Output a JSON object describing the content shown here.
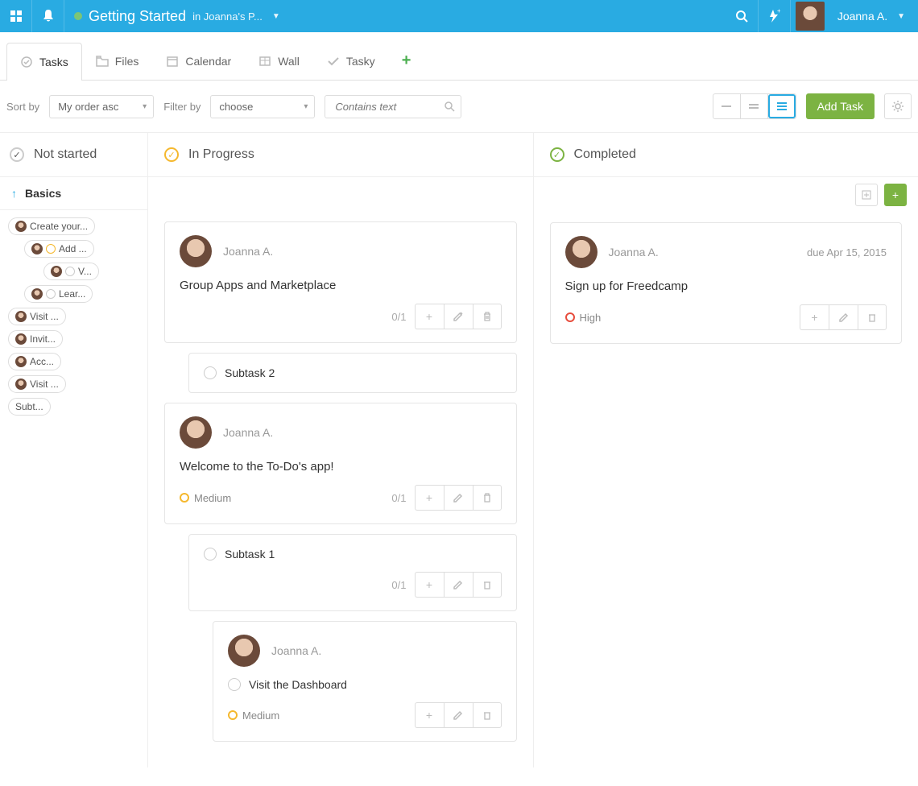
{
  "header": {
    "title": "Getting Started",
    "subtitle": "in Joanna's P...",
    "user_name": "Joanna A."
  },
  "tabs": [
    {
      "label": "Tasks",
      "active": true
    },
    {
      "label": "Files",
      "active": false
    },
    {
      "label": "Calendar",
      "active": false
    },
    {
      "label": "Wall",
      "active": false
    },
    {
      "label": "Tasky",
      "active": false
    }
  ],
  "toolbar": {
    "sort_label": "Sort by",
    "sort_value": "My order asc",
    "filter_label": "Filter by",
    "filter_value": "choose",
    "search_placeholder": "Contains text",
    "add_task_label": "Add Task"
  },
  "columns": {
    "not_started": {
      "title": "Not started"
    },
    "in_progress": {
      "title": "In Progress"
    },
    "completed": {
      "title": "Completed"
    }
  },
  "group": {
    "name": "Basics"
  },
  "mini_tasks": [
    {
      "label": "Create your...",
      "indent": 0,
      "avatar": true
    },
    {
      "label": "Add ...",
      "indent": 1,
      "avatar": true,
      "circle": "yellow"
    },
    {
      "label": "V...",
      "indent": 2,
      "avatar": true,
      "circle": "grey"
    },
    {
      "label": "Lear...",
      "indent": 1,
      "avatar": true,
      "circle": "grey"
    },
    {
      "label": "Visit ...",
      "indent": 0,
      "avatar": true
    },
    {
      "label": "Invit...",
      "indent": 0,
      "avatar": true
    },
    {
      "label": "Acc...",
      "indent": 0,
      "avatar": true
    },
    {
      "label": "Visit ...",
      "indent": 0,
      "avatar": true
    },
    {
      "label": "Subt...",
      "indent": 0,
      "avatar": false
    }
  ],
  "in_progress_cards": [
    {
      "user": "Joanna A.",
      "title": "Group Apps and Marketplace",
      "count": "0/1",
      "priority": null,
      "subtasks": [
        {
          "title": "Subtask 2",
          "count": null
        }
      ]
    },
    {
      "user": "Joanna A.",
      "title": "Welcome to the To-Do's app!",
      "count": "0/1",
      "priority": {
        "label": "Medium",
        "level": "med"
      },
      "subtasks": [
        {
          "title": "Subtask 1",
          "count": "0/1",
          "nested": [
            {
              "user": "Joanna A.",
              "title": "Visit the Dashboard",
              "priority": {
                "label": "Medium",
                "level": "med"
              }
            }
          ]
        }
      ]
    }
  ],
  "completed_cards": [
    {
      "user": "Joanna A.",
      "title": "Sign up for Freedcamp",
      "due": "due Apr 15, 2015",
      "priority": {
        "label": "High",
        "level": "high"
      }
    }
  ]
}
